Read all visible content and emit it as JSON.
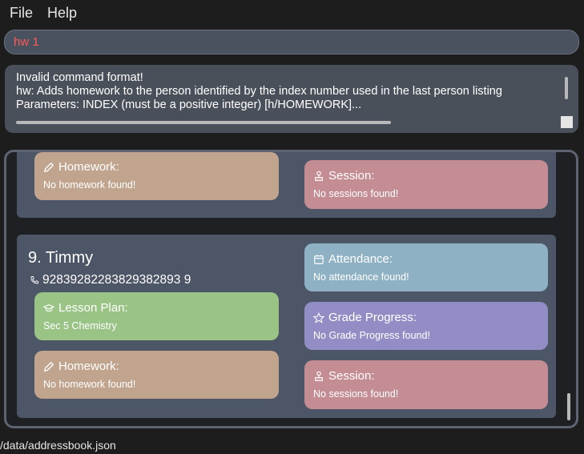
{
  "menu": {
    "file": "File",
    "help": "Help"
  },
  "command": {
    "value": "hw 1"
  },
  "result": {
    "line1": "Invalid command format!",
    "line2": "hw: Adds homework to the person identified by the index number used in the last person listing",
    "line3": "Parameters: INDEX (must be a positive integer) [h/HOMEWORK]..."
  },
  "card_top": {
    "homework_title": "Homework:",
    "homework_text": "No homework found!",
    "session_title": "Session:",
    "session_text": "No sessions found!"
  },
  "card_timmy": {
    "index": "9.",
    "name": "Timmy",
    "phone": "92839282283829382893 9",
    "lesson_title": "Lesson Plan:",
    "lesson_text": "Sec 5 Chemistry",
    "homework_title": "Homework:",
    "homework_text": "No homework found!",
    "attendance_title": "Attendance:",
    "attendance_text": "No attendance found!",
    "grade_title": "Grade Progress:",
    "grade_text": "No Grade Progress found!",
    "session_title": "Session:",
    "session_text": "No sessions found!"
  },
  "status": {
    "path": "/data/addressbook.json"
  }
}
